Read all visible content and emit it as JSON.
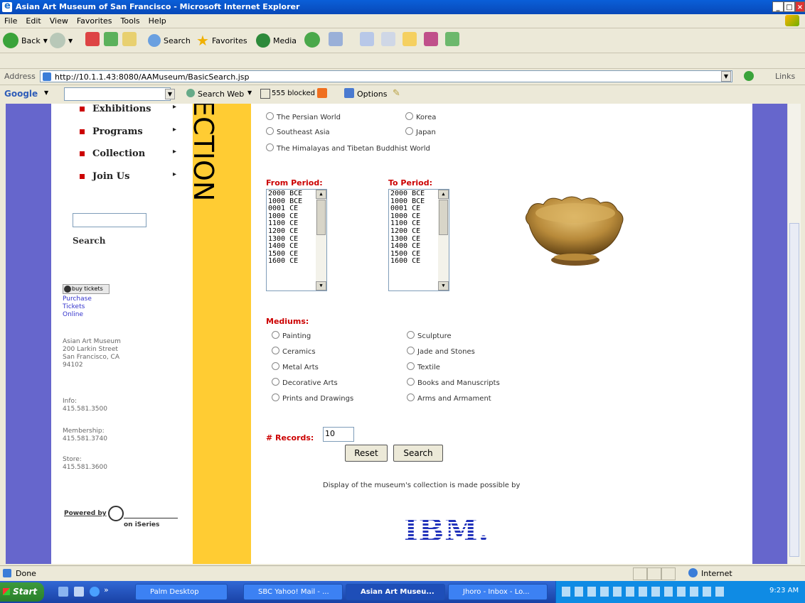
{
  "window": {
    "title": "Asian Art Museum of San Francisco - Microsoft Internet Explorer"
  },
  "menu": [
    "File",
    "Edit",
    "View",
    "Favorites",
    "Tools",
    "Help"
  ],
  "toolbar": {
    "back": "Back",
    "search": "Search",
    "favorites": "Favorites",
    "media": "Media"
  },
  "address": {
    "label": "Address",
    "url": "http://10.1.1.43:8080/AAMuseum/BasicSearch.jsp",
    "links": "Links"
  },
  "google": {
    "logo": "Google",
    "search_web": "Search Web",
    "blocked": "555 blocked",
    "options": "Options"
  },
  "sidebar": {
    "nav": [
      {
        "label": "Exhibitions"
      },
      {
        "label": "Programs"
      },
      {
        "label": "Collection"
      },
      {
        "label": "Join Us"
      }
    ],
    "search_label": "Search",
    "buy_tickets": "buy tickets",
    "purchase_links": [
      "Purchase",
      "Tickets",
      "Online"
    ],
    "address_lines": [
      "Asian Art Museum",
      "200 Larkin Street",
      "San Francisco, CA",
      "94102"
    ],
    "info_label": "Info:",
    "info_phone": "415.581.3500",
    "membership_label": "Membership:",
    "membership_phone": "415.581.3740",
    "store_label": "Store:",
    "store_phone": "415.581.3600",
    "powered_by": "Powered by",
    "on_iseries": "on iSeries"
  },
  "banner_text": "ECTION",
  "regions": {
    "left": [
      "The Persian World",
      "Southeast Asia"
    ],
    "right": [
      "Korea",
      "Japan"
    ],
    "full": "The Himalayas and Tibetan Buddhist World"
  },
  "from_period": {
    "label": "From Period:",
    "options": [
      "2000 BCE",
      "1000 BCE",
      "0001 CE",
      "1000 CE",
      "1100 CE",
      "1200 CE",
      "1300 CE",
      "1400 CE",
      "1500 CE",
      "1600 CE"
    ]
  },
  "to_period": {
    "label": "To Period:",
    "options": [
      "2000 BCE",
      "1000 BCE",
      "0001 CE",
      "1000 CE",
      "1100 CE",
      "1200 CE",
      "1300 CE",
      "1400 CE",
      "1500 CE",
      "1600 CE"
    ]
  },
  "mediums": {
    "label": "Mediums:",
    "left": [
      "Painting",
      "Ceramics",
      "Metal Arts",
      "Decorative Arts",
      "Prints and Drawings"
    ],
    "right": [
      "Sculpture",
      "Jade and Stones",
      "Textile",
      "Books and Manuscripts",
      "Arms and Armament"
    ]
  },
  "records": {
    "label": "# Records:",
    "value": "10"
  },
  "buttons": {
    "reset": "Reset",
    "search": "Search"
  },
  "sponsor_text": "Display of the museum's collection is made possible by",
  "sponsor_logo": "IBM.",
  "status": {
    "text": "Done",
    "zone": "Internet"
  },
  "taskbar": {
    "start": "Start",
    "tasks": [
      "Palm Desktop",
      "SBC Yahoo! Mail - ...",
      "Asian Art Museu...",
      "Jhoro - Inbox - Lo..."
    ],
    "clock": "9:23 AM"
  },
  "colors": {
    "purple": "#6666cc",
    "yellow": "#ffcc33",
    "red_label": "#cc0000",
    "ibm_blue": "#2233bb"
  }
}
